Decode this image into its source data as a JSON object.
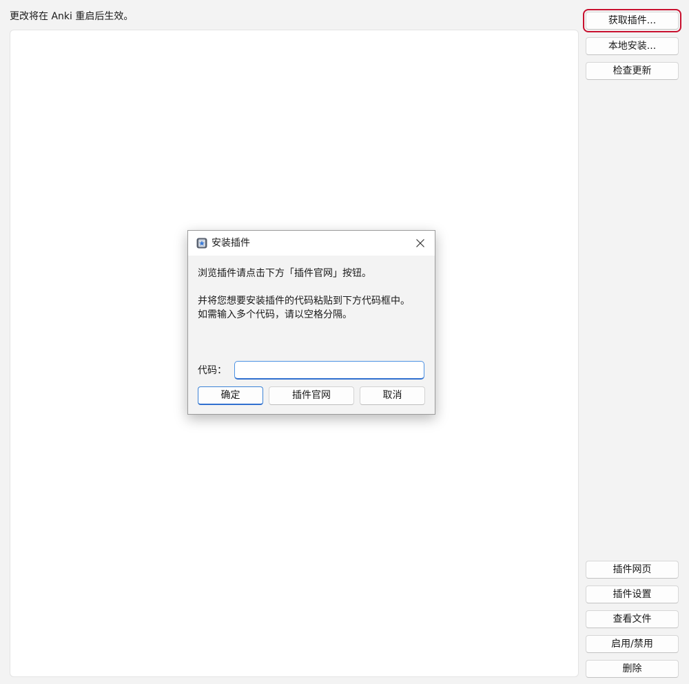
{
  "notice_text": "更改将在 Anki 重启后生效。",
  "side_buttons_top": {
    "get_addons": "获取插件...",
    "install_from_file": "本地安装...",
    "check_updates": "检查更新"
  },
  "side_buttons_bottom": {
    "addon_page": "插件网页",
    "addon_config": "插件设置",
    "view_files": "查看文件",
    "toggle_enabled": "启用/禁用",
    "delete": "删除"
  },
  "dialog": {
    "title": "安装插件",
    "line1": "浏览插件请点击下方「插件官网」按钮。",
    "line2": "并将您想要安装插件的代码粘贴到下方代码框中。",
    "line3": "如需输入多个代码，请以空格分隔。",
    "code_label": "代码：",
    "code_value": "",
    "ok_label": "确定",
    "browse_label": "插件官网",
    "cancel_label": "取消"
  },
  "colors": {
    "highlight_frame": "#c8102e",
    "focus_accent": "#2f6fcf"
  }
}
